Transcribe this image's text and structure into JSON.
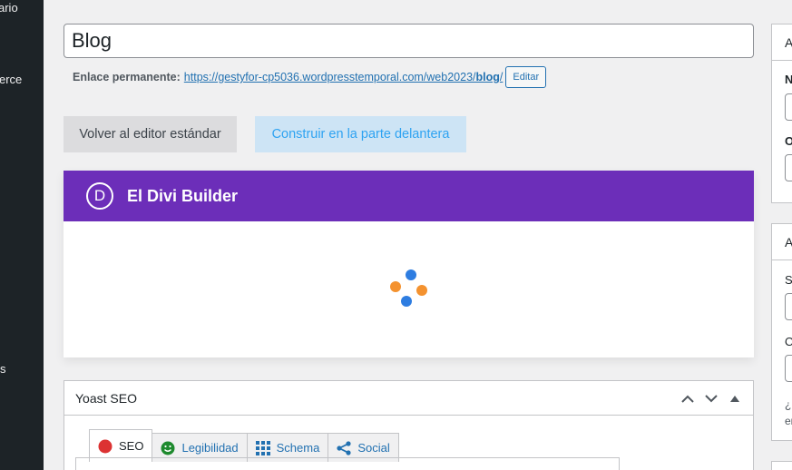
{
  "sidebar": {
    "fragments": [
      "ario",
      "erce",
      "s"
    ]
  },
  "post": {
    "title": "Blog",
    "permalink_label": "Enlace permanente:",
    "permalink_url": "https://gestyfor-cp5036.wordpresstemporal.com/web2023/",
    "permalink_slug": "blog",
    "permalink_tail": "/",
    "edit_label": "Editar"
  },
  "actions": {
    "standard_editor": "Volver al editor estándar",
    "front_builder": "Construir en la parte delantera"
  },
  "divi": {
    "logo_letter": "D",
    "title": "El Divi Builder",
    "spinner_colors": [
      "#2e7de1",
      "#f4922f",
      "#f4922f",
      "#2e7de1"
    ]
  },
  "yoast": {
    "title": "Yoast SEO",
    "tabs": [
      {
        "label": "SEO",
        "icon": "red-circle-icon"
      },
      {
        "label": "Legibilidad",
        "icon": "smiley-icon"
      },
      {
        "label": "Schema",
        "icon": "grid-icon"
      },
      {
        "label": "Social",
        "icon": "share-icon"
      }
    ]
  },
  "right_panels": {
    "panel1": {
      "header": "A",
      "label1": "N",
      "label2": "O"
    },
    "panel2": {
      "header": "A",
      "label1": "S",
      "label2": "O",
      "text1": "¿N",
      "text2": "er"
    }
  },
  "colors": {
    "divi_purple": "#6c2eb9",
    "wp_blue": "#2271b1",
    "admin_dark": "#1d2327"
  }
}
